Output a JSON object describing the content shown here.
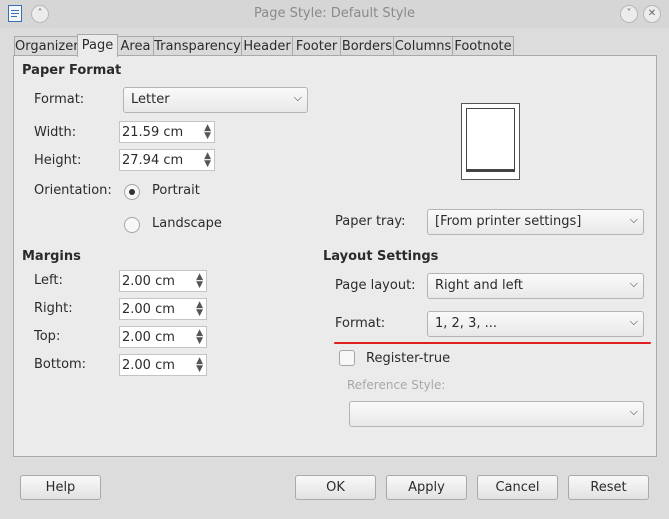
{
  "window": {
    "title": "Page Style: Default Style"
  },
  "tabs": [
    "Organizer",
    "Page",
    "Area",
    "Transparency",
    "Header",
    "Footer",
    "Borders",
    "Columns",
    "Footnote"
  ],
  "paper_format": {
    "heading": "Paper Format",
    "format_label": "Format:",
    "format_value": "Letter",
    "width_label": "Width:",
    "width_value": "21.59 cm",
    "height_label": "Height:",
    "height_value": "27.94 cm",
    "orientation_label": "Orientation:",
    "portrait_label": "Portrait",
    "landscape_label": "Landscape",
    "orientation_selected": "Portrait",
    "paper_tray_label": "Paper tray:",
    "paper_tray_value": "[From printer settings]"
  },
  "margins": {
    "heading": "Margins",
    "left_label": "Left:",
    "left_value": "2.00 cm",
    "right_label": "Right:",
    "right_value": "2.00 cm",
    "top_label": "Top:",
    "top_value": "2.00 cm",
    "bottom_label": "Bottom:",
    "bottom_value": "2.00 cm"
  },
  "layout": {
    "heading": "Layout Settings",
    "page_layout_label": "Page layout:",
    "page_layout_value": "Right and left",
    "format_label": "Format:",
    "format_value": "1, 2, 3, ...",
    "register_true_label": "Register-true",
    "register_true_checked": false,
    "reference_style_label": "Reference Style:",
    "reference_style_value": ""
  },
  "buttons": {
    "help": "Help",
    "ok": "OK",
    "apply": "Apply",
    "cancel": "Cancel",
    "reset": "Reset"
  },
  "colors": {
    "annotation_underline": "#e0201e"
  }
}
